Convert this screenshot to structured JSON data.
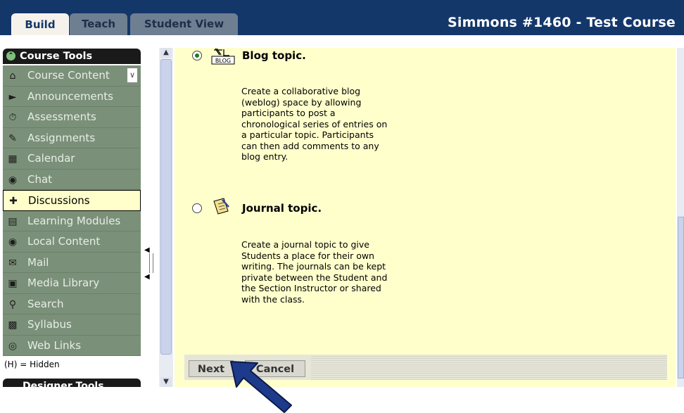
{
  "header": {
    "tabs": [
      {
        "label": "Build",
        "active": true
      },
      {
        "label": "Teach",
        "active": false
      },
      {
        "label": "Student View",
        "active": false
      }
    ],
    "course_title": "Simmons #1460 - Test Course"
  },
  "sidebar": {
    "section_title": "Course Tools",
    "items": [
      {
        "label": "Course Content",
        "icon": "home-icon"
      },
      {
        "label": "Announcements",
        "icon": "megaphone-icon"
      },
      {
        "label": "Assessments",
        "icon": "stopwatch-icon"
      },
      {
        "label": "Assignments",
        "icon": "pencil-paper-icon"
      },
      {
        "label": "Calendar",
        "icon": "calendar-icon"
      },
      {
        "label": "Chat",
        "icon": "speech-bubble-icon"
      },
      {
        "label": "Discussions",
        "icon": "pushpin-icon",
        "selected": true
      },
      {
        "label": "Learning Modules",
        "icon": "book-icon"
      },
      {
        "label": "Local Content",
        "icon": "disc-icon"
      },
      {
        "label": "Mail",
        "icon": "envelope-icon"
      },
      {
        "label": "Media Library",
        "icon": "media-icon"
      },
      {
        "label": "Search",
        "icon": "magnifier-icon"
      },
      {
        "label": "Syllabus",
        "icon": "syllabus-icon"
      },
      {
        "label": "Web Links",
        "icon": "globe-icon"
      }
    ],
    "hidden_note": "(H) = Hidden",
    "designer_title": "Designer Tools"
  },
  "main": {
    "options": [
      {
        "title": "Blog topic.",
        "icon_text": "BLOG",
        "selected": true,
        "description": "Create a collaborative blog (weblog) space by allowing participants to post a chronological series of entries on a particular topic. Participants can then add comments to any blog entry."
      },
      {
        "title": "Journal topic.",
        "selected": false,
        "description": "Create a journal topic to give Students a place for their own writing. The journals can be kept private between the Student and the Section Instructor or shared with the class."
      }
    ]
  },
  "buttons": {
    "next_label": "Next",
    "cancel_label": "Cancel"
  },
  "colors": {
    "header_bg": "#14376a",
    "sidebar_item_bg": "#7b9079",
    "content_bg": "#ffffcc",
    "pointer_arrow": "#1e3a8a"
  }
}
